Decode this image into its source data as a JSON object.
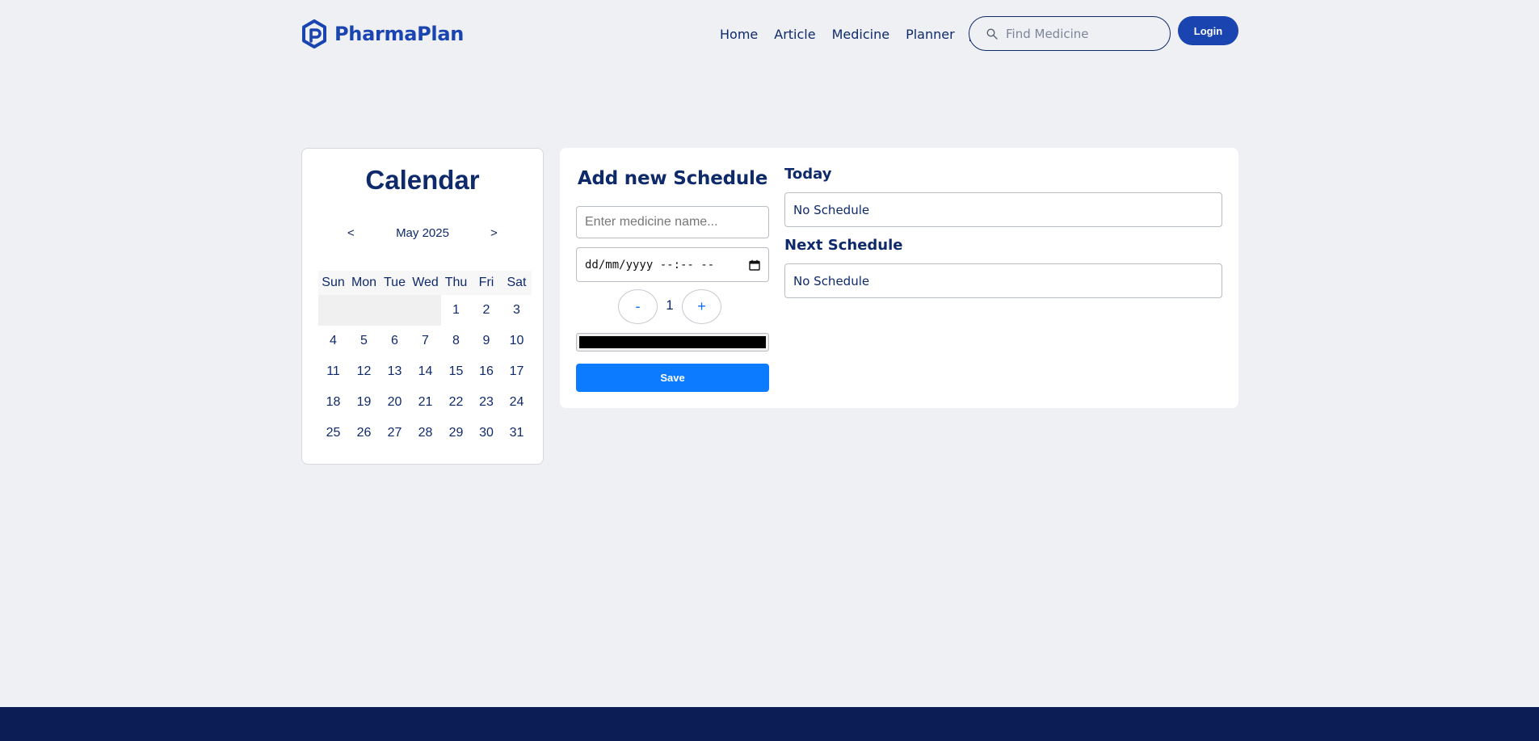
{
  "brand": {
    "name": "PharmaPlan"
  },
  "nav": {
    "items": [
      "Home",
      "Article",
      "Medicine",
      "Planner"
    ]
  },
  "search": {
    "placeholder": "Find Medicine"
  },
  "header": {
    "login_label": "Login"
  },
  "calendar": {
    "title": "Calendar",
    "prev": "<",
    "next": ">",
    "month_label": "May 2025",
    "weekdays": [
      "Sun",
      "Mon",
      "Tue",
      "Wed",
      "Thu",
      "Fri",
      "Sat"
    ],
    "weeks": [
      [
        "",
        "",
        "",
        "",
        "1",
        "2",
        "3"
      ],
      [
        "4",
        "5",
        "6",
        "7",
        "8",
        "9",
        "10"
      ],
      [
        "11",
        "12",
        "13",
        "14",
        "15",
        "16",
        "17"
      ],
      [
        "18",
        "19",
        "20",
        "21",
        "22",
        "23",
        "24"
      ],
      [
        "25",
        "26",
        "27",
        "28",
        "29",
        "30",
        "31"
      ]
    ]
  },
  "schedule_form": {
    "title": "Add new Schedule",
    "medicine_placeholder": "Enter medicine name...",
    "datetime_placeholder": "dd/mm/yyyy --:-- --",
    "minus": "-",
    "plus": "+",
    "quantity": "1",
    "color": "#000000",
    "save_label": "Save"
  },
  "today": {
    "label": "Today",
    "value": "No Schedule"
  },
  "next_schedule": {
    "label": "Next Schedule",
    "value": "No Schedule"
  },
  "colors": {
    "primary": "#1a44b0",
    "navy": "#0f2a6b",
    "save_button": "#0d7bff",
    "footer": "#0b1d54",
    "background": "#eef0f4"
  }
}
